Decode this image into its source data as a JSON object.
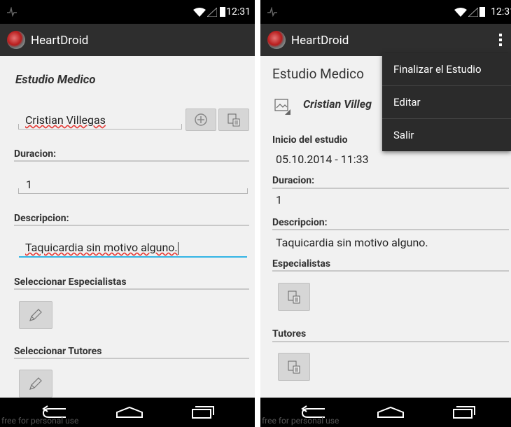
{
  "status": {
    "time_left": "12:31",
    "time_right": "12:31"
  },
  "app": {
    "name": "HeartDroid"
  },
  "edit_screen": {
    "title": "Estudio Medico",
    "patient_name": "Cristian Villegas",
    "duracion_label": "Duracion:",
    "duracion_value": "1",
    "descripcion_label": "Descripcion:",
    "descripcion_value": "Taquicardia sin motivo alguno.",
    "especialistas_label": "Seleccionar Especialistas",
    "tutores_label": "Seleccionar Tutores"
  },
  "detail_screen": {
    "title": "Estudio Medico",
    "patient_name": "Cristian Villeg",
    "inicio_label": "Inicio del estudio",
    "inicio_value": "05.10.2014 - 11:33",
    "duracion_label": "Duracion:",
    "duracion_value": "1",
    "descripcion_label": "Descripcion:",
    "descripcion_value": "Taquicardia sin motivo alguno.",
    "especialistas_label": "Especialistas",
    "tutores_label": "Tutores"
  },
  "menu": {
    "items": [
      "Finalizar el Estudio",
      "Editar",
      "Salir"
    ]
  },
  "watermark": "free for personal use",
  "colors": {
    "actionbar": "#2e2e2e",
    "focus_underline": "#33b5e5",
    "background": "#f1f1f1"
  }
}
